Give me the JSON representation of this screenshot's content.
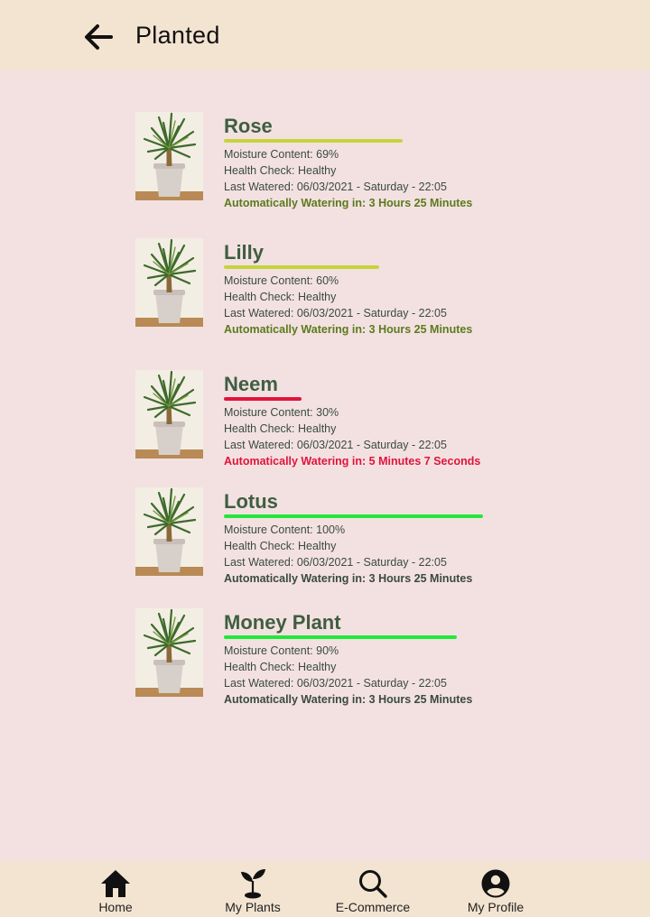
{
  "header": {
    "title": "Planted"
  },
  "colors": {
    "name": "#3f5e41",
    "bar_good": "#c6d43b",
    "bar_low": "#e0143c",
    "bar_full": "#22e83a",
    "auto_green": "#5c7a1c",
    "auto_red": "#e0143c",
    "auto_dark": "#3a4a3c"
  },
  "plants": [
    {
      "name": "Rose",
      "moisture": "Moisture Content: 69%",
      "moisture_pct": 69,
      "health": "Health Check: Healthy",
      "watered": "Last Watered: 06/03/2021 - Saturday - 22:05",
      "auto": "Automatically Watering in: 3 Hours 25 Minutes"
    },
    {
      "name": "Lilly",
      "moisture": "Moisture Content: 60%",
      "moisture_pct": 60,
      "health": "Health Check: Healthy",
      "watered": "Last Watered: 06/03/2021 - Saturday - 22:05",
      "auto": "Automatically Watering in: 3 Hours 25 Minutes"
    },
    {
      "name": "Neem",
      "moisture": "Moisture Content: 30%",
      "moisture_pct": 30,
      "health": "Health Check: Healthy",
      "watered": "Last Watered: 06/03/2021 - Saturday - 22:05",
      "auto": "Automatically Watering in: 5 Minutes 7 Seconds"
    },
    {
      "name": "Lotus",
      "moisture": "Moisture Content: 100%",
      "moisture_pct": 100,
      "health": "Health Check: Healthy",
      "watered": "Last Watered: 06/03/2021 - Saturday - 22:05",
      "auto": "Automatically Watering in: 3 Hours 25 Minutes"
    },
    {
      "name": "Money Plant",
      "moisture": "Moisture Content: 90%",
      "moisture_pct": 90,
      "health": "Health Check: Healthy",
      "watered": "Last Watered: 06/03/2021 - Saturday - 22:05",
      "auto": "Automatically Watering in: 3 Hours 25 Minutes"
    }
  ],
  "nav": {
    "home": {
      "label": "Home",
      "icon": "home-icon"
    },
    "plants": {
      "label": "My Plants",
      "icon": "sprout-icon"
    },
    "ecommerce": {
      "label": "E-Commerce",
      "icon": "search-icon"
    },
    "profile": {
      "label": "My Profile",
      "icon": "account-circle-icon"
    }
  }
}
